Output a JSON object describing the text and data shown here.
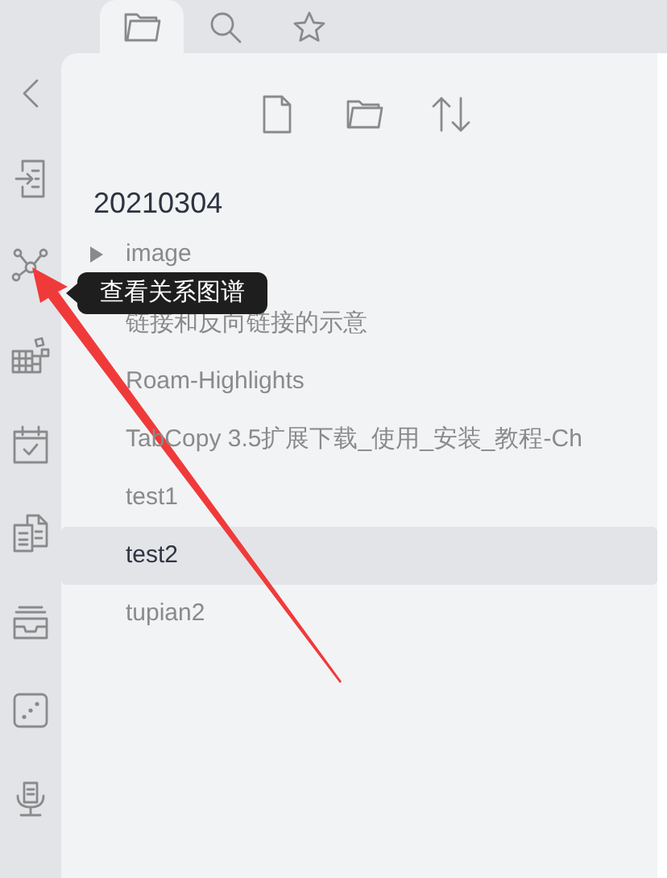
{
  "tabs": [
    {
      "kind": "folder",
      "selected": true
    },
    {
      "kind": "search",
      "selected": false
    },
    {
      "kind": "star",
      "selected": false
    }
  ],
  "rail": [
    {
      "kind": "collapse"
    },
    {
      "kind": "import"
    },
    {
      "kind": "graph"
    },
    {
      "kind": "blocks"
    },
    {
      "kind": "calendar"
    },
    {
      "kind": "copy"
    },
    {
      "kind": "inbox"
    },
    {
      "kind": "dice"
    },
    {
      "kind": "mic"
    }
  ],
  "toolbar": [
    {
      "kind": "new-file"
    },
    {
      "kind": "new-folder"
    },
    {
      "kind": "sort"
    }
  ],
  "vault_title": "20210304",
  "files": [
    {
      "name": "image",
      "kind": "folder",
      "selected": false
    },
    {
      "name": "链接和反向链接的示意",
      "kind": "file",
      "selected": false
    },
    {
      "name": "Roam-Highlights",
      "kind": "file",
      "selected": false
    },
    {
      "name": "TabCopy 3.5扩展下载_使用_安装_教程-Ch",
      "kind": "file",
      "selected": false
    },
    {
      "name": "test1",
      "kind": "file",
      "selected": false
    },
    {
      "name": "test2",
      "kind": "file",
      "selected": true
    },
    {
      "name": "tupian2",
      "kind": "file",
      "selected": false
    }
  ],
  "tooltip": "查看关系图谱"
}
